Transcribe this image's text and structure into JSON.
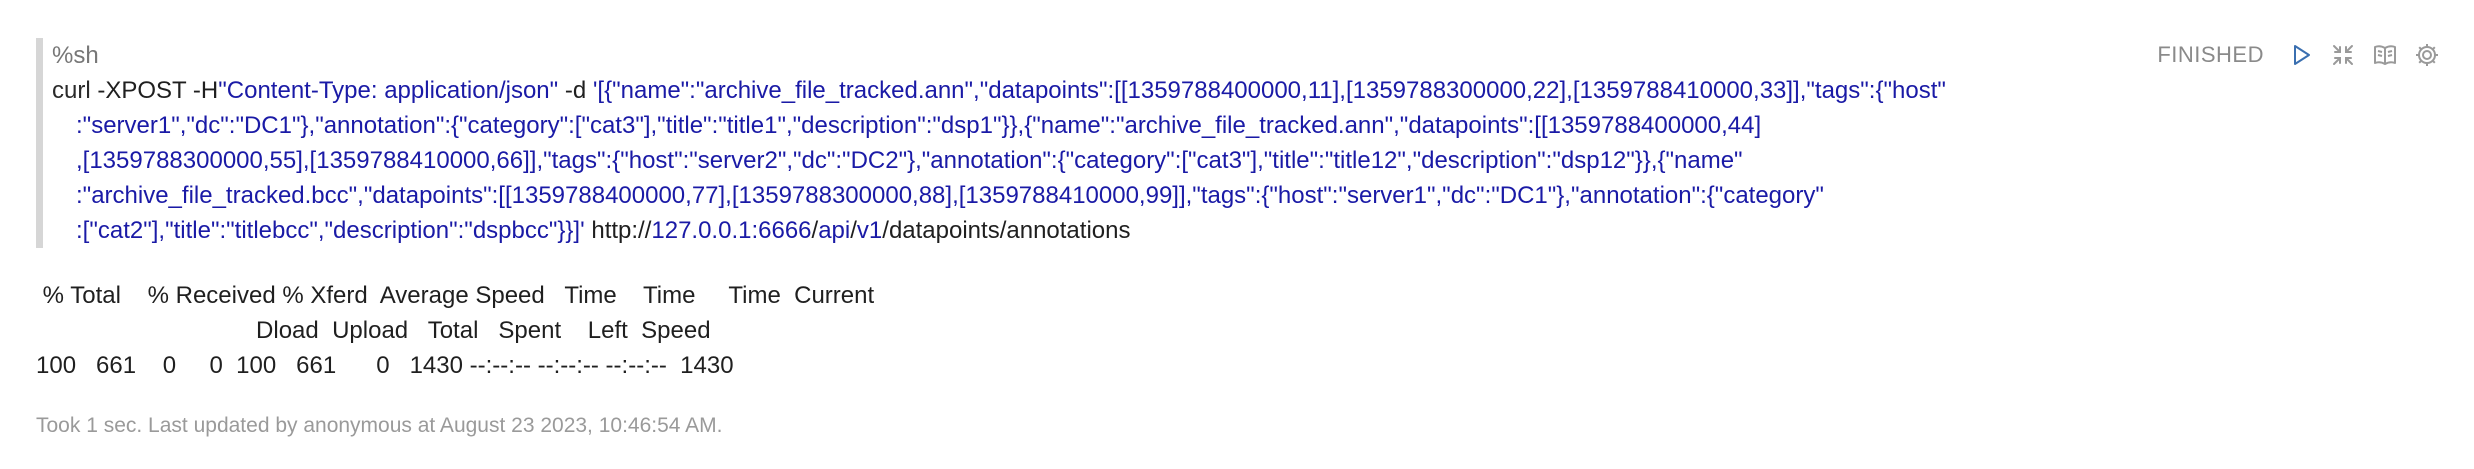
{
  "paragraph": {
    "status": "FINISHED",
    "controls": {
      "run_icon": "run-triangle-icon",
      "collapse_icon": "collapse-arrows-icon",
      "book_icon": "book-icon",
      "settings_icon": "gear-icon",
      "accent_color": "#3a6fb0"
    },
    "code": {
      "magic": "%sh",
      "lines": [
        {
          "a": "curl",
          "b": " -XPOST -H",
          "c": "\"Content-Type: application/json\"",
          "d": " -d ",
          "e": "'[{\"name\":\"archive_file_tracked.ann\",\"datapoints\":[[1359788400000,11],[1359788300000,22],[1359788410000,33]],\"tags\":{\"host\""
        },
        {
          "e": ":\"server1\",\"dc\":\"DC1\"},\"annotation\":{\"category\":[\"cat3\"],\"title\":\"title1\",\"description\":\"dsp1\"}},{\"name\":\"archive_file_tracked.ann\",\"datapoints\":[[1359788400000,44]"
        },
        {
          "e": ",[1359788300000,55],[1359788410000,66]],\"tags\":{\"host\":\"server2\",\"dc\":\"DC2\"},\"annotation\":{\"category\":[\"cat3\"],\"title\":\"title12\",\"description\":\"dsp12\"}},{\"name\""
        },
        {
          "e": ":\"archive_file_tracked.bcc\",\"datapoints\":[[1359788400000,77],[1359788300000,88],[1359788410000,99]],\"tags\":{\"host\":\"server1\",\"dc\":\"DC1\"},\"annotation\":{\"category\""
        },
        {
          "e": ":[\"cat2\"],\"title\":\"titlebcc\",\"description\":\"dspbcc\"}}]'",
          "f": " http://",
          "g": "127.0.0.1:6666",
          "h": "/",
          "i": "api",
          "j": "/",
          "k": "v1",
          "l": "/",
          "m": "datapoints",
          "n": "/",
          "o": "annotations"
        }
      ]
    },
    "output": {
      "lines": [
        " % Total    % Received % Xferd  Average Speed   Time    Time     Time  Current",
        "                                 Dload  Upload   Total   Spent    Left  Speed",
        "100   661    0     0  100   661      0   1430 --:--:-- --:--:-- --:--:--  1430"
      ]
    },
    "footer": "Took 1 sec. Last updated by anonymous at August 23 2023, 10:46:54 AM."
  }
}
